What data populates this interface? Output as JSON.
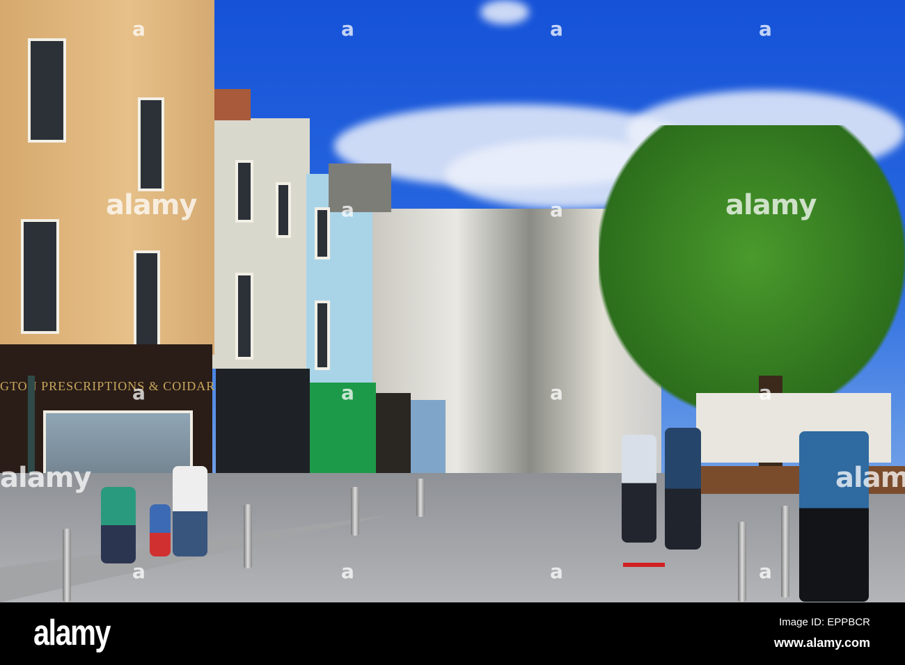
{
  "photo": {
    "shop_sign": "GTON PRESCRIPTIONS & COIDAR",
    "watermark_letter": "a",
    "watermark_word": "alamy"
  },
  "footer": {
    "logo": "alamy",
    "image_id": "Image ID: EPPBCR",
    "website": "www.alamy.com"
  },
  "colors": {
    "sky": "#1552d8",
    "tan_building": "#e2b97c",
    "tree": "#2f7a1f",
    "road": "#9ea0a3"
  }
}
